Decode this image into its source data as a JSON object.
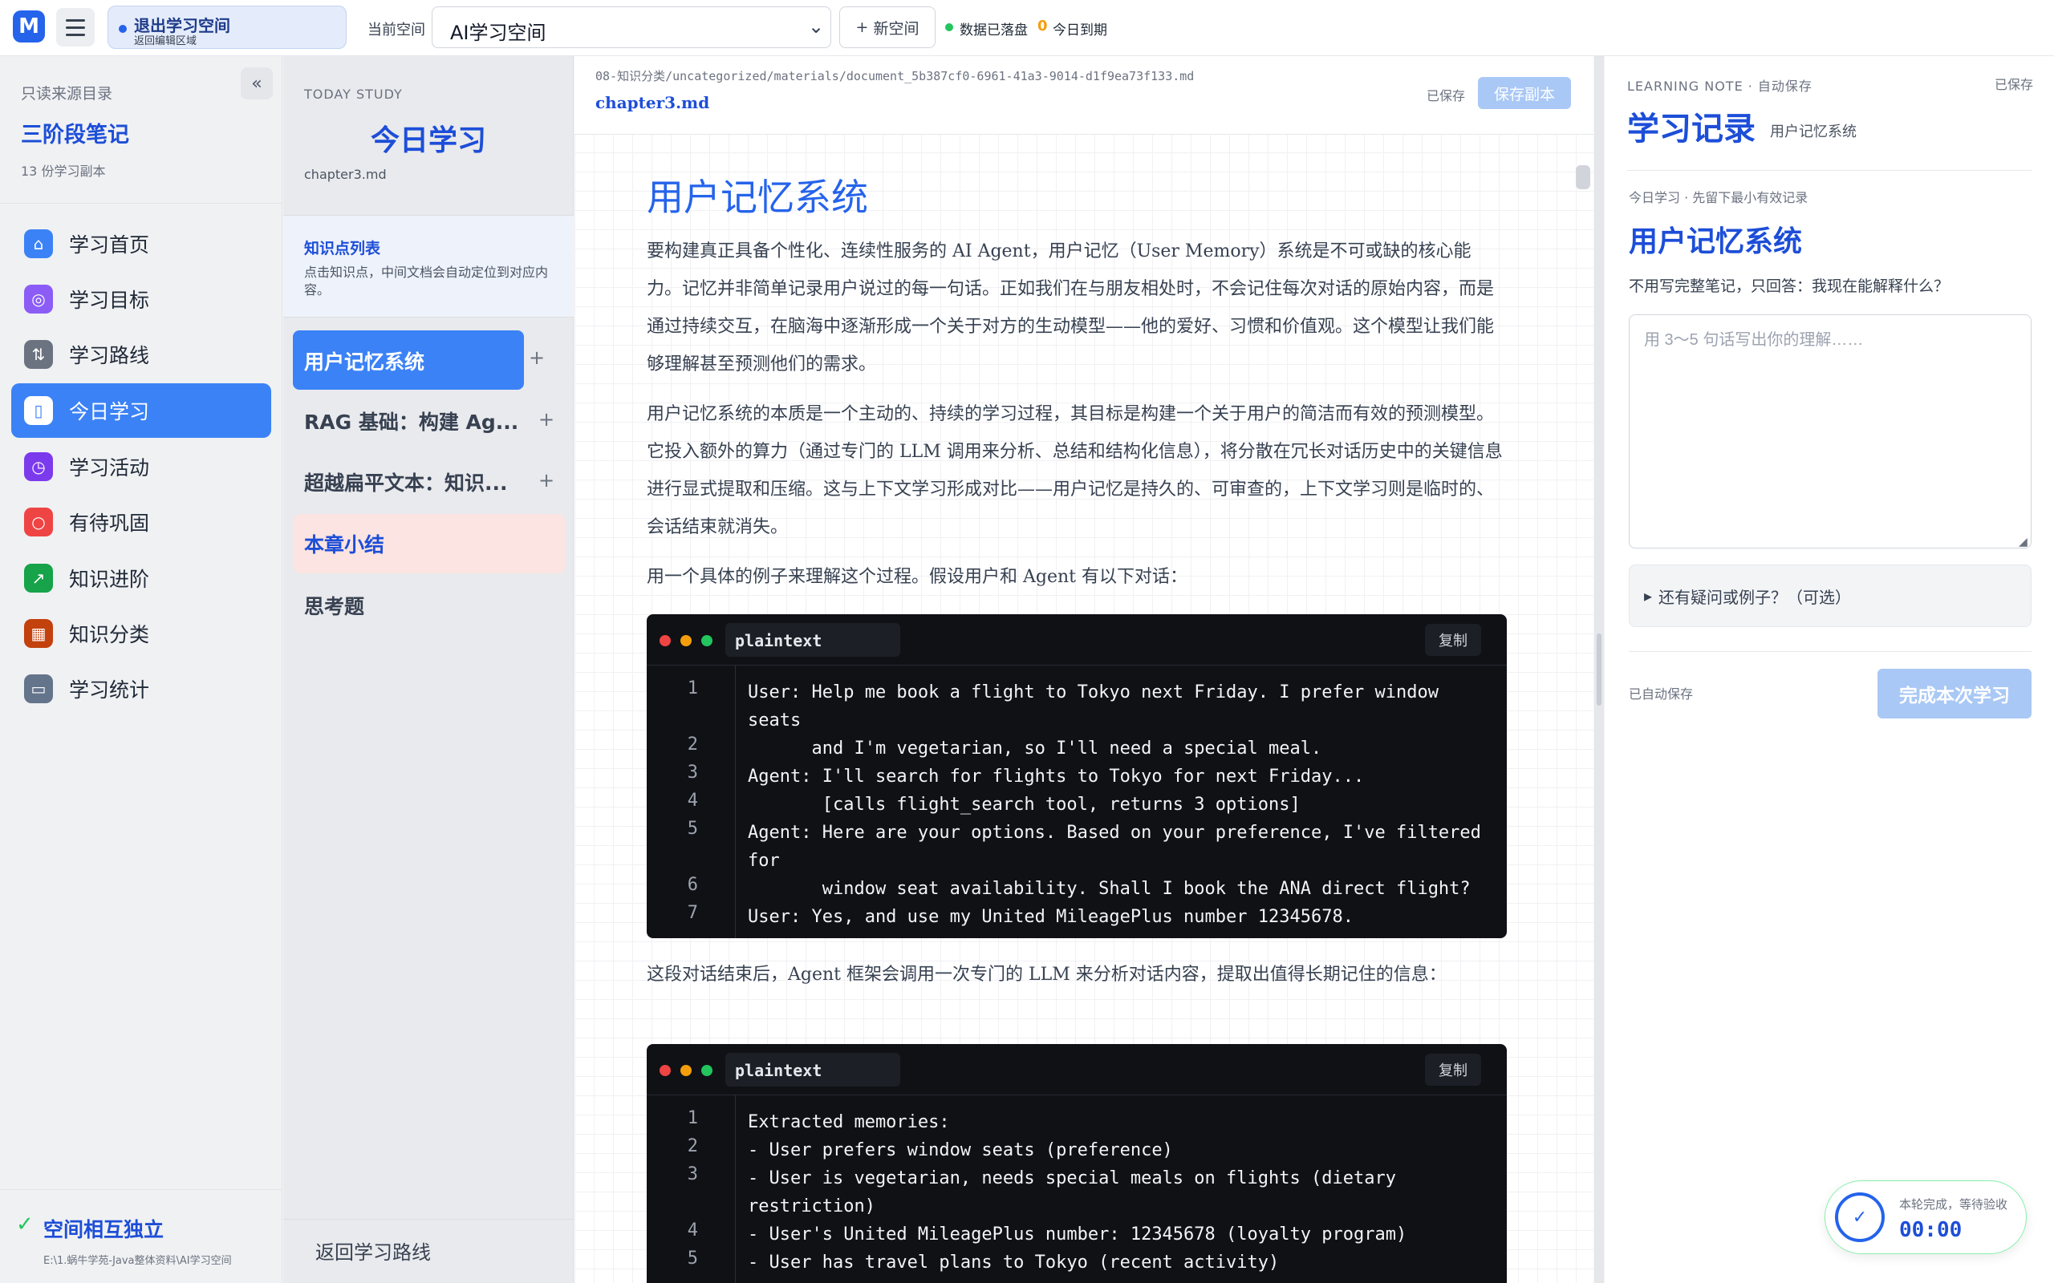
{
  "topbar": {
    "logo": "M",
    "exit_title": "退出学习空间",
    "exit_sub": "返回编辑区域",
    "space_label": "当前空间",
    "space_value": "AI学习空间",
    "new_space": "新空间",
    "saved_status": "数据已落盘",
    "due_count": "0",
    "due_label": "今日到期"
  },
  "sidebar": {
    "source_label": "只读来源目录",
    "book_title": "三阶段笔记",
    "book_count": "13 份学习副本",
    "items": [
      {
        "label": "学习首页",
        "icon": "home-icon",
        "color": "#3b82f6"
      },
      {
        "label": "学习目标",
        "icon": "target-icon",
        "color": "#8b5cf6"
      },
      {
        "label": "学习路线",
        "icon": "route-icon",
        "color": "#6b7280"
      },
      {
        "label": "今日学习",
        "icon": "book-icon",
        "color": "#3b82f6",
        "active": true
      },
      {
        "label": "学习活动",
        "icon": "clock-icon",
        "color": "#7c3aed"
      },
      {
        "label": "有待巩固",
        "icon": "search-icon",
        "color": "#ef4444"
      },
      {
        "label": "知识进阶",
        "icon": "chart-icon",
        "color": "#16a34a"
      },
      {
        "label": "知识分类",
        "icon": "grid-icon",
        "color": "#c2410c"
      },
      {
        "label": "学习统计",
        "icon": "folder-icon",
        "color": "#64748b"
      }
    ],
    "footer_title": "空间相互独立",
    "footer_path": "E:\\1.蜗牛学苑-Java整体资料\\AI学习空间"
  },
  "today": {
    "kicker": "TODAY STUDY",
    "title": "今日学习",
    "file": "chapter3.md",
    "list_title": "知识点列表",
    "list_desc": "点击知识点，中间文档会自动定位到对应内容。",
    "points": [
      {
        "label": "用户记忆系统",
        "active": true
      },
      {
        "label": "RAG 基础：构建 Ag..."
      },
      {
        "label": "超越扁平文本：知识..."
      },
      {
        "label": "本章小结",
        "highlight": true
      },
      {
        "label": "思考题"
      }
    ],
    "back_route": "返回学习路线"
  },
  "document": {
    "path": "08-知识分类/uncategorized/materials/document_5b387cf0-6961-41a3-9014-d1f9ea73f133.md",
    "file": "chapter3.md",
    "saved": "已保存",
    "save_copy": "保存副本",
    "heading": "用户记忆系统",
    "paragraphs": [
      "要构建真正具备个性化、连续性服务的 AI Agent，用户记忆（User Memory）系统是不可或缺的核心能力。记忆并非简单记录用户说过的每一句话。正如我们在与朋友相处时，不会记住每次对话的原始内容，而是通过持续交互，在脑海中逐渐形成一个关于对方的生动模型——他的爱好、习惯和价值观。这个模型让我们能够理解甚至预测他们的需求。",
      "用户记忆系统的本质是一个主动的、持续的学习过程，其目标是构建一个关于用户的简洁而有效的预测模型。它投入额外的算力（通过专门的 LLM 调用来分析、总结和结构化信息），将分散在冗长对话历史中的关键信息进行显式提取和压缩。这与上下文学习形成对比——用户记忆是持久的、可审查的，上下文学习则是临时的、会话结束就消失。",
      "用一个具体的例子来理解这个过程。假设用户和 Agent 有以下对话：",
      "这段对话结束后，Agent 框架会调用一次专门的 LLM 来分析对话内容，提取出值得长期记住的信息："
    ],
    "code_blocks": [
      {
        "lang": "plaintext",
        "copy": "复制",
        "lines": [
          {
            "n": "1",
            "text": "User: Help me book a flight to Tokyo next Friday. I prefer window seats"
          },
          {
            "n": "2",
            "text": "      and I'm vegetarian, so I'll need a special meal."
          },
          {
            "n": "3",
            "text": "Agent: I'll search for flights to Tokyo for next Friday..."
          },
          {
            "n": "4",
            "text": "       [calls flight_search tool, returns 3 options]"
          },
          {
            "n": "5",
            "text": "Agent: Here are your options. Based on your preference, I've filtered for"
          },
          {
            "n": "6",
            "text": "       window seat availability. Shall I book the ANA direct flight?"
          },
          {
            "n": "7",
            "text": "User: Yes, and use my United MileagePlus number 12345678."
          }
        ]
      },
      {
        "lang": "plaintext",
        "copy": "复制",
        "lines": [
          {
            "n": "1",
            "text": "Extracted memories:"
          },
          {
            "n": "2",
            "text": "- User prefers window seats (preference)"
          },
          {
            "n": "3",
            "text": "- User is vegetarian, needs special meals on flights (dietary restriction)"
          },
          {
            "n": "4",
            "text": "- User's United MileagePlus number: 12345678 (loyalty program)"
          },
          {
            "n": "5",
            "text": "- User has travel plans to Tokyo (recent activity)"
          }
        ]
      }
    ]
  },
  "notes": {
    "kicker": "LEARNING NOTE · 自动保存",
    "saved": "已保存",
    "title": "学习记录",
    "subtitle": "用户记忆系统",
    "hint": "今日学习 · 先留下最小有效记录",
    "topic": "用户记忆系统",
    "question": "不用写完整笔记，只回答：我现在能解释什么？",
    "placeholder": "用 3～5 句话写出你的理解……",
    "more": "还有疑问或例子？（可选）",
    "autosaved": "已自动保存",
    "finish": "完成本次学习"
  },
  "timer": {
    "label": "本轮完成，等待验收",
    "time": "00:00"
  }
}
